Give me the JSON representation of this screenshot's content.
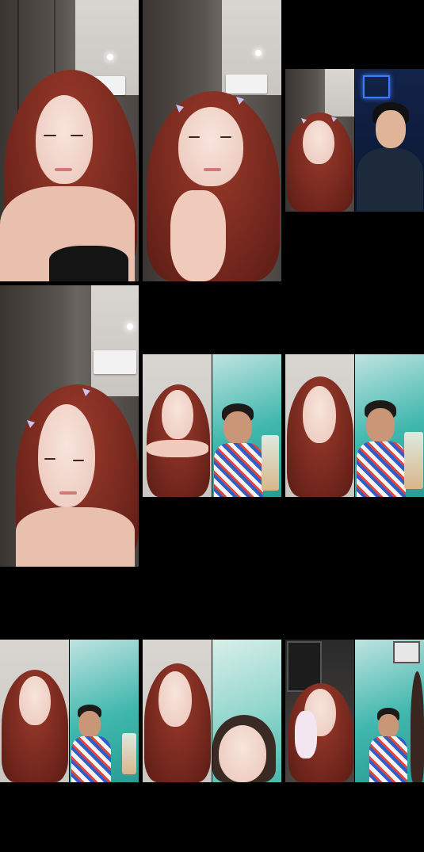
{
  "grid": {
    "columns": 3,
    "tiles": [
      {
        "name": "stream-tile-1",
        "people": [
          "woman"
        ]
      },
      {
        "name": "stream-tile-2",
        "people": [
          "woman"
        ]
      },
      {
        "name": "stream-tile-3",
        "people": [
          "woman",
          "man"
        ]
      },
      {
        "name": "stream-tile-4",
        "people": [
          "woman"
        ]
      },
      {
        "name": "stream-tile-5",
        "people": [
          "woman",
          "boy"
        ]
      },
      {
        "name": "stream-tile-6",
        "people": [
          "woman",
          "boy"
        ]
      },
      {
        "name": "stream-tile-7",
        "people": [
          "woman",
          "boy"
        ]
      },
      {
        "name": "stream-tile-8",
        "people": [
          "woman",
          "woman"
        ]
      },
      {
        "name": "stream-tile-9",
        "people": [
          "woman",
          "boy"
        ]
      }
    ]
  },
  "colors": {
    "background": "#000000",
    "hair": "#7a2a1f",
    "teal_wall": "#3fb7ad",
    "neon": "#3d7bff"
  }
}
